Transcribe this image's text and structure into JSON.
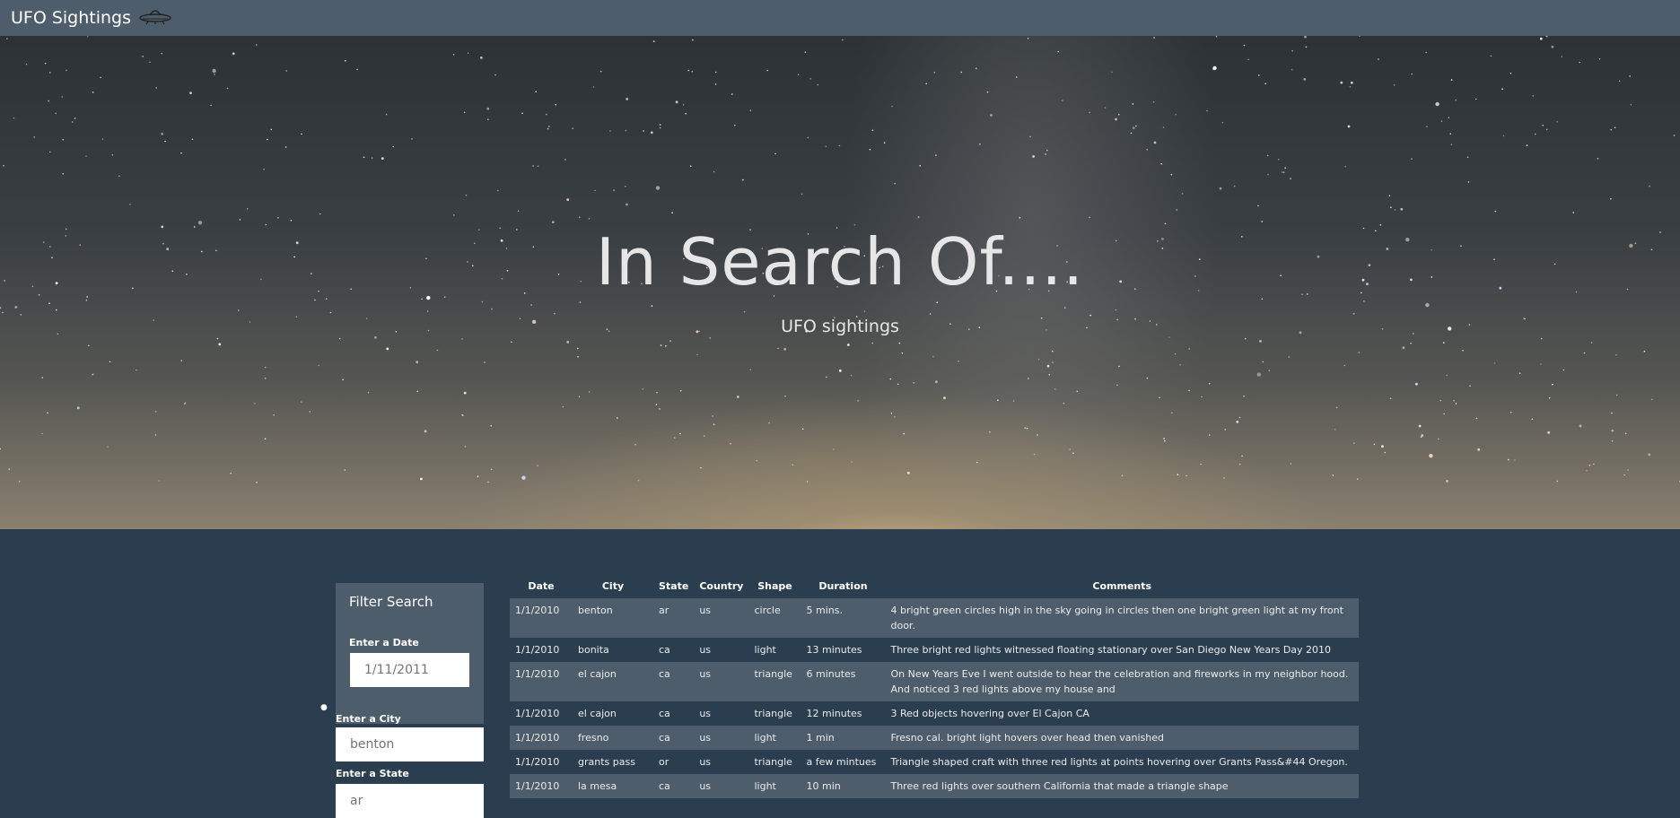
{
  "navbar": {
    "brand": "UFO Sightings",
    "brand_icon": "ufo-icon"
  },
  "hero": {
    "title": "In Search Of....",
    "subtitle": "UFO sightings"
  },
  "filter": {
    "heading": "Filter Search",
    "date_label": "Enter a Date",
    "date_placeholder": "1/11/2011",
    "city_label": "Enter a City",
    "city_placeholder": "benton",
    "state_label": "Enter a State",
    "state_placeholder": "ar"
  },
  "table": {
    "headers": [
      "Date",
      "City",
      "State",
      "Country",
      "Shape",
      "Duration",
      "Comments"
    ],
    "rows": [
      [
        "1/1/2010",
        "benton",
        "ar",
        "us",
        "circle",
        "5 mins.",
        "4 bright green circles high in the sky going in circles then one bright green light at my front door."
      ],
      [
        "1/1/2010",
        "bonita",
        "ca",
        "us",
        "light",
        "13 minutes",
        "Three bright red lights witnessed floating stationary over San Diego New Years Day 2010"
      ],
      [
        "1/1/2010",
        "el cajon",
        "ca",
        "us",
        "triangle",
        "6 minutes",
        "On New Years Eve I went outside to hear the celebration and fireworks in my neighbor hood. And noticed 3 red lights above my house and"
      ],
      [
        "1/1/2010",
        "el cajon",
        "ca",
        "us",
        "triangle",
        "12 minutes",
        "3 Red objects hovering over El Cajon CA"
      ],
      [
        "1/1/2010",
        "fresno",
        "ca",
        "us",
        "light",
        "1 min",
        "Fresno cal. bright light hovers over head then vanished"
      ],
      [
        "1/1/2010",
        "grants pass",
        "or",
        "us",
        "triangle",
        "a few mintues",
        "Triangle shaped craft with three red lights at points hovering over Grants Pass&#44 Oregon."
      ],
      [
        "1/1/2010",
        "la mesa",
        "ca",
        "us",
        "light",
        "10 min",
        "Three red lights over southern California that made a triangle shape"
      ]
    ]
  }
}
